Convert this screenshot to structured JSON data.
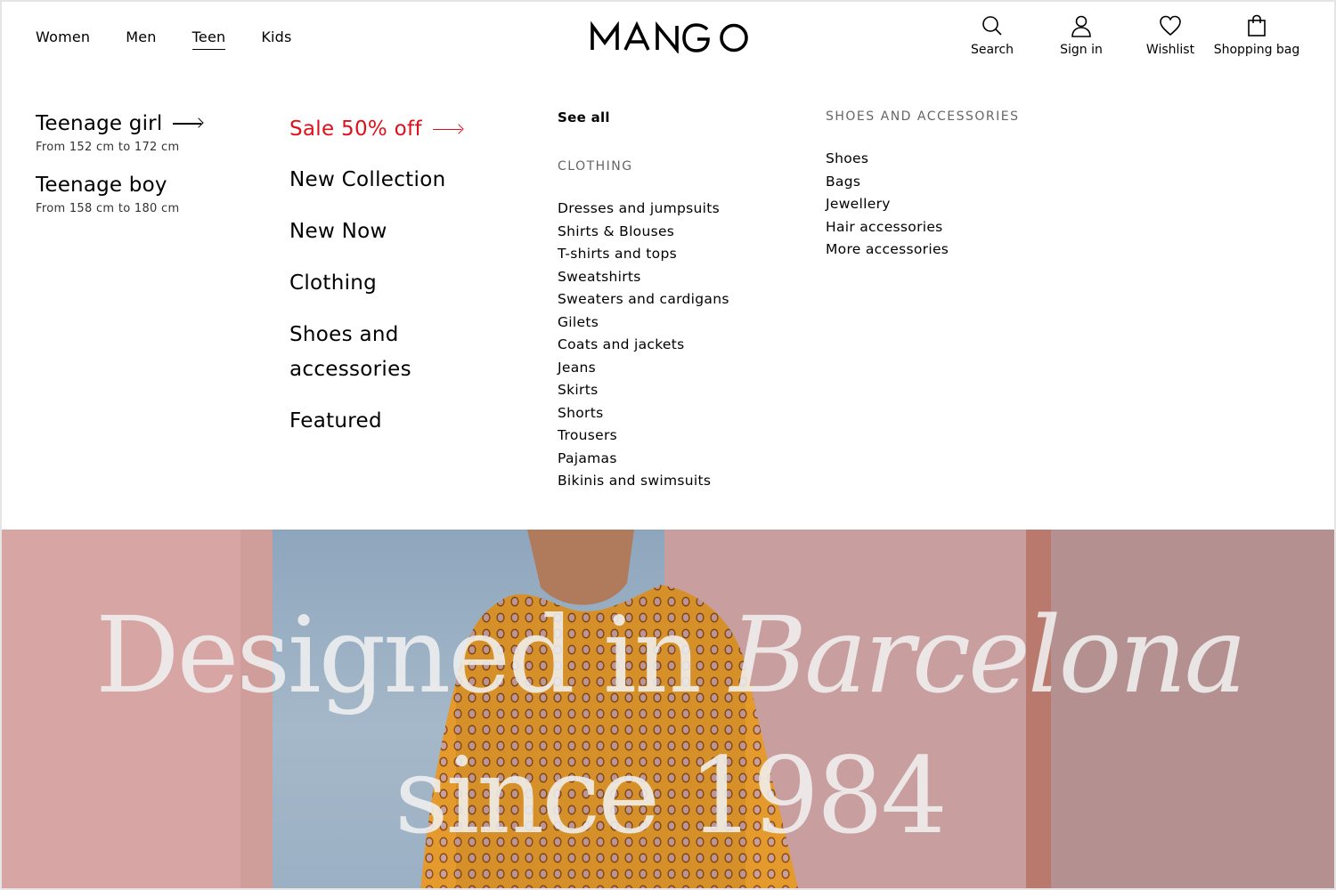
{
  "header": {
    "nav": [
      "Women",
      "Men",
      "Teen",
      "Kids"
    ],
    "active_nav": "Teen",
    "logo_text": "MANGO",
    "actions": {
      "search": "Search",
      "sign_in": "Sign in",
      "wishlist": "Wishlist",
      "bag": "Shopping bag"
    }
  },
  "menu": {
    "segments": [
      {
        "title": "Teenage girl",
        "subtitle": "From 152 cm to 172 cm"
      },
      {
        "title": "Teenage boy",
        "subtitle": "From 158 cm to 180 cm"
      }
    ],
    "main_links": {
      "sale": "Sale 50% off",
      "new_collection": "New Collection",
      "new_now": "New Now",
      "clothing": "Clothing",
      "shoes_accessories_line1": "Shoes and",
      "shoes_accessories_line2": "accessories",
      "featured": "Featured"
    },
    "see_all": "See all",
    "clothing_heading": "CLOTHING",
    "clothing_items": [
      "Dresses and jumpsuits",
      "Shirts & Blouses",
      "T-shirts and tops",
      "Sweatshirts",
      "Sweaters and cardigans",
      "Gilets",
      "Coats and jackets",
      "Jeans",
      "Skirts",
      "Shorts",
      "Trousers",
      "Pajamas",
      "Bikinis and swimsuits"
    ],
    "shoes_heading": "SHOES AND ACCESSORIES",
    "shoes_items": [
      "Shoes",
      "Bags",
      "Jewellery",
      "Hair accessories",
      "More accessories"
    ]
  },
  "hero": {
    "line1_regular": "Designed in ",
    "line1_italic": "Barcelona",
    "line2": "since 1984"
  },
  "colors": {
    "sale": "#e0101a",
    "heading_gray": "#666666",
    "hero_wall": "#d7a5a3",
    "sweater": "#e49a2c"
  }
}
